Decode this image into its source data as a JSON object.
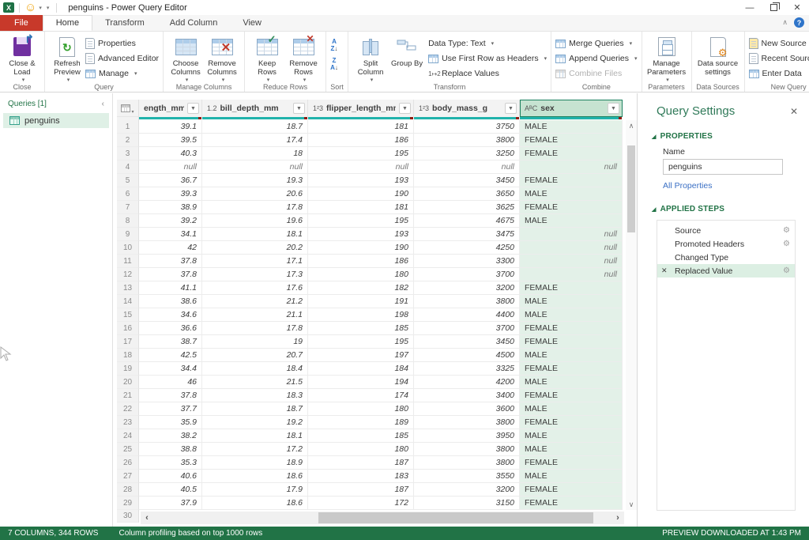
{
  "window": {
    "title": "penguins - Power Query Editor",
    "controls": {
      "minimize": "—",
      "restore": "restore",
      "close": "✕",
      "help": "?"
    }
  },
  "tabs": {
    "items": [
      "File",
      "Home",
      "Transform",
      "Add Column",
      "View"
    ],
    "selected": "Home"
  },
  "ribbon": {
    "groups": [
      {
        "label": "Close"
      },
      {
        "label": "Query"
      },
      {
        "label": "Manage Columns"
      },
      {
        "label": "Reduce Rows"
      },
      {
        "label": "Sort"
      },
      {
        "label": "Transform"
      },
      {
        "label": "Combine"
      },
      {
        "label": "Parameters"
      },
      {
        "label": "Data Sources"
      },
      {
        "label": "New Query"
      }
    ],
    "buttons": {
      "close_load": "Close & Load",
      "refresh_preview": "Refresh Preview",
      "properties": "Properties",
      "advanced_editor": "Advanced Editor",
      "manage": "Manage",
      "choose_columns": "Choose Columns",
      "remove_columns": "Remove Columns",
      "keep_rows": "Keep Rows",
      "remove_rows": "Remove Rows",
      "sort_az": "AZ↓",
      "sort_za": "ZA↓",
      "split_column": "Split Column",
      "group_by": "Group By",
      "data_type": "Data Type: Text",
      "use_first_row": "Use First Row as Headers",
      "replace_values": "Replace Values",
      "merge_queries": "Merge Queries",
      "append_queries": "Append Queries",
      "combine_files": "Combine Files",
      "manage_parameters": "Manage Parameters",
      "data_source_settings": "Data source settings",
      "new_source": "New Source",
      "recent_sources": "Recent Sources",
      "enter_data": "Enter Data"
    }
  },
  "queries_panel": {
    "header": "Queries [1]",
    "collapse": "‹",
    "items": [
      {
        "name": "penguins",
        "selected": true
      }
    ]
  },
  "grid": {
    "columns": [
      {
        "type_glyph": "",
        "name": "ength_mm"
      },
      {
        "type_glyph": "1.2",
        "name": "bill_depth_mm"
      },
      {
        "type_glyph": "1²3",
        "name": "flipper_length_mm"
      },
      {
        "type_glyph": "1²3",
        "name": "body_mass_g"
      },
      {
        "type_glyph": "AᴮC",
        "name": "sex",
        "selected": true
      }
    ],
    "rows": [
      [
        "39.1",
        "18.7",
        "181",
        "3750",
        "MALE"
      ],
      [
        "39.5",
        "17.4",
        "186",
        "3800",
        "FEMALE"
      ],
      [
        "40.3",
        "18",
        "195",
        "3250",
        "FEMALE"
      ],
      [
        null,
        null,
        null,
        null,
        null
      ],
      [
        "36.7",
        "19.3",
        "193",
        "3450",
        "FEMALE"
      ],
      [
        "39.3",
        "20.6",
        "190",
        "3650",
        "MALE"
      ],
      [
        "38.9",
        "17.8",
        "181",
        "3625",
        "FEMALE"
      ],
      [
        "39.2",
        "19.6",
        "195",
        "4675",
        "MALE"
      ],
      [
        "34.1",
        "18.1",
        "193",
        "3475",
        null
      ],
      [
        "42",
        "20.2",
        "190",
        "4250",
        null
      ],
      [
        "37.8",
        "17.1",
        "186",
        "3300",
        null
      ],
      [
        "37.8",
        "17.3",
        "180",
        "3700",
        null
      ],
      [
        "41.1",
        "17.6",
        "182",
        "3200",
        "FEMALE"
      ],
      [
        "38.6",
        "21.2",
        "191",
        "3800",
        "MALE"
      ],
      [
        "34.6",
        "21.1",
        "198",
        "4400",
        "MALE"
      ],
      [
        "36.6",
        "17.8",
        "185",
        "3700",
        "FEMALE"
      ],
      [
        "38.7",
        "19",
        "195",
        "3450",
        "FEMALE"
      ],
      [
        "42.5",
        "20.7",
        "197",
        "4500",
        "MALE"
      ],
      [
        "34.4",
        "18.4",
        "184",
        "3325",
        "FEMALE"
      ],
      [
        "46",
        "21.5",
        "194",
        "4200",
        "MALE"
      ],
      [
        "37.8",
        "18.3",
        "174",
        "3400",
        "FEMALE"
      ],
      [
        "37.7",
        "18.7",
        "180",
        "3600",
        "MALE"
      ],
      [
        "35.9",
        "19.2",
        "189",
        "3800",
        "FEMALE"
      ],
      [
        "38.2",
        "18.1",
        "185",
        "3950",
        "MALE"
      ],
      [
        "38.8",
        "17.2",
        "180",
        "3800",
        "MALE"
      ],
      [
        "35.3",
        "18.9",
        "187",
        "3800",
        "FEMALE"
      ],
      [
        "40.6",
        "18.6",
        "183",
        "3550",
        "MALE"
      ],
      [
        "40.5",
        "17.9",
        "187",
        "3200",
        "FEMALE"
      ],
      [
        "37.9",
        "18.6",
        "172",
        "3150",
        "FEMALE"
      ]
    ],
    "null_display": "null",
    "row30_label": "30"
  },
  "query_settings": {
    "title": "Query Settings",
    "properties_header": "PROPERTIES",
    "name_label": "Name",
    "name_value": "penguins",
    "all_properties_link": "All Properties",
    "applied_steps_header": "APPLIED STEPS",
    "steps": [
      {
        "name": "Source",
        "gear": true,
        "selected": false,
        "removable": false
      },
      {
        "name": "Promoted Headers",
        "gear": true,
        "selected": false,
        "removable": false
      },
      {
        "name": "Changed Type",
        "gear": false,
        "selected": false,
        "removable": false
      },
      {
        "name": "Replaced Value",
        "gear": true,
        "selected": true,
        "removable": true
      }
    ]
  },
  "status_bar": {
    "left": "7 COLUMNS, 344 ROWS",
    "middle": "Column profiling based on top 1000 rows",
    "right": "PREVIEW DOWNLOADED AT 1:43 PM"
  },
  "icons": {
    "gear": "⚙",
    "delete": "✕",
    "caret": "▾",
    "up": "∧",
    "down": "∨",
    "left": "‹",
    "right": "›"
  },
  "colors": {
    "excel_green": "#217346",
    "file_tab_red": "#c8392a",
    "quality_bar_teal": "#21b3ab",
    "quality_bar_error": "#8f1d13",
    "selection_green": "#dff0e6",
    "link_blue": "#3a6fc4"
  }
}
